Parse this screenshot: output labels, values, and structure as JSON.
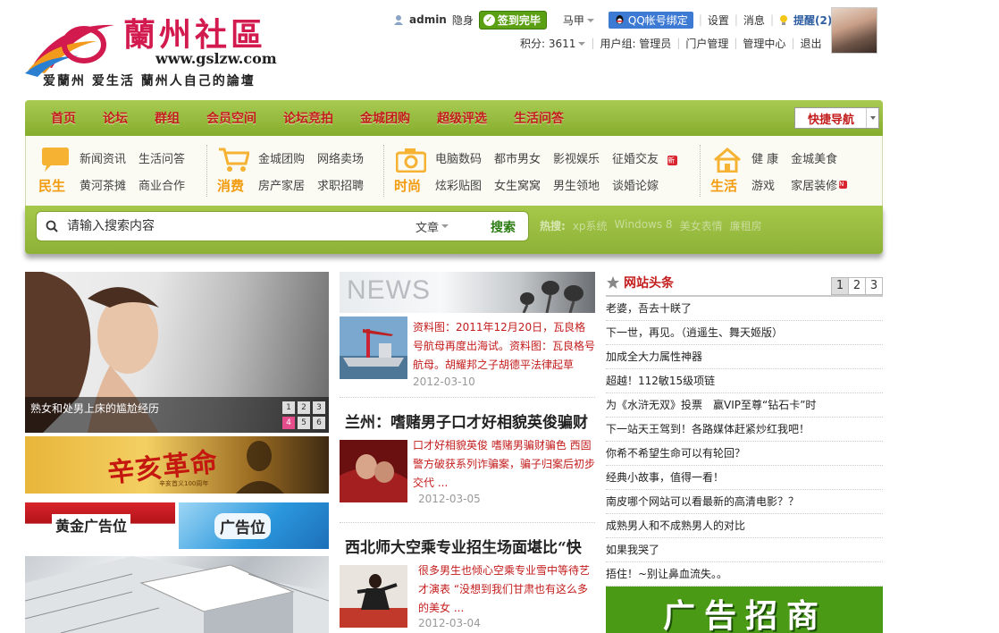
{
  "logo": {
    "brand": "蘭州社區",
    "url": "www.gslzw.com",
    "tagline": "爱蘭州 爱生活 蘭州人自己的論壇"
  },
  "userbar": {
    "username": "admin",
    "invisible": "隐身",
    "signed": "签到完毕",
    "vest": "马甲",
    "qq_bind": "QQ帐号绑定",
    "settings": "设置",
    "messages": "消息",
    "remind": "提醒(2)",
    "points": "积分: 3611",
    "usergroup": "用户组: 管理员",
    "portal_admin": "门户管理",
    "admin_center": "管理中心",
    "logout": "退出"
  },
  "nav": {
    "items": [
      "首页",
      "论坛",
      "群组",
      "会员空间",
      "论坛竞拍",
      "金城团购",
      "超级评选",
      "生活问答"
    ],
    "quick": "快捷导航"
  },
  "categories": [
    {
      "label": "民生",
      "links": [
        "新闻资讯",
        "黄河茶摊",
        "生活问答",
        "商业合作"
      ]
    },
    {
      "label": "消费",
      "links": [
        "金城团购",
        "房产家居",
        "网络卖场",
        "求职招聘"
      ]
    },
    {
      "label": "时尚",
      "links": [
        "电脑数码",
        "炫彩贴图",
        "都市男女",
        "女生窝窝",
        "影视娱乐",
        "男生领地",
        "征婚交友",
        "谈婚论嫁"
      ]
    },
    {
      "label": "生活",
      "links": [
        "健 康",
        "游戏",
        "金城美食",
        "家居装修"
      ]
    }
  ],
  "search": {
    "placeholder": "请输入搜索内容",
    "type": "文章",
    "button": "搜索",
    "hot_label": "热搜:",
    "hot_words": [
      "xp系统",
      "Windows 8",
      "美女表情",
      "廉租房"
    ]
  },
  "slide": {
    "caption": "熟女和处男上床的尴尬经历",
    "pages": [
      "1",
      "2",
      "3",
      "4",
      "5",
      "6"
    ],
    "active_page": "4"
  },
  "banners": {
    "xinhai": "辛亥革命",
    "xinhai_sub": "辛亥首义100周年",
    "gold_ad": "黄金广告位",
    "ad": "广告位",
    "zhaoshang": "广告招商"
  },
  "news": {
    "banner": "NEWS",
    "items": [
      {
        "text": "资料图：2011年12月20日，瓦良格号航母再度出海试。资料图：瓦良格号航母。胡耀邦之子胡德平法律起草",
        "date": "2012-03-10"
      },
      {
        "title": "兰州：嗜赌男子口才好相貌英俊骗财",
        "text": "口才好相貌英俊 嗜赌男骗财骗色 西固警方破获系列诈骗案，骗子归案后初步交代 ...",
        "date": "2012-03-05"
      },
      {
        "title": "西北师大空乘专业招生场面堪比“快",
        "text": "很多男生也倾心空乘专业雪中等待艺才演表 “没想到我们甘肃也有这么多的美女 ...",
        "date": "2012-03-04"
      }
    ]
  },
  "headlines": {
    "title": "网站头条",
    "pages": [
      "1",
      "2",
      "3"
    ],
    "items": [
      "老婆，吾去十眹了",
      "下一世，再见。（逍遥生、舞天姬版）",
      "加成全大力属性神器",
      "超越！112敏15级项链",
      "为《水浒无双》投票　赢VIP至尊“钻石卡”时",
      "下一站天王驾到！各路媒体赶紧炒红我吧！",
      "你希不希望生命可以有轮回？",
      "经典小故事，值得一看！",
      "南皮哪个网站可以看最新的高清电影？？",
      "成熟男人和不成熟男人的对比",
      "如果我哭了",
      "捂住！~别让鼻血流失。。"
    ]
  }
}
